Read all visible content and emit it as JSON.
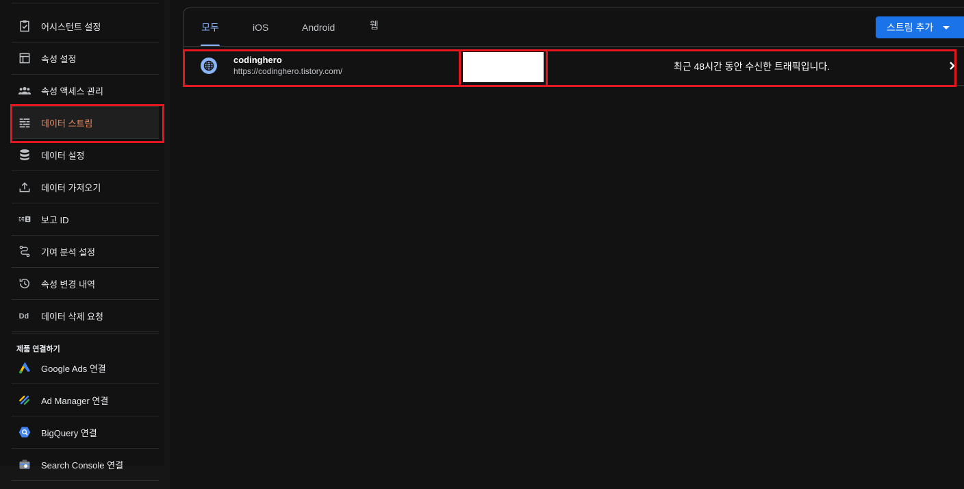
{
  "sidebar": {
    "items": [
      {
        "label": "어시스턴트 설정",
        "icon": "clipboard-check-icon"
      },
      {
        "label": "속성 설정",
        "icon": "property-frame-icon"
      },
      {
        "label": "속성 액세스 관리",
        "icon": "people-icon"
      },
      {
        "label": "데이터 스트림",
        "icon": "data-streams-icon"
      },
      {
        "label": "데이터 설정",
        "icon": "database-icon"
      },
      {
        "label": "데이터 가져오기",
        "icon": "upload-icon"
      },
      {
        "label": "보고 ID",
        "icon": "reporting-id-icon"
      },
      {
        "label": "기여 분석 설정",
        "icon": "attribution-path-icon"
      },
      {
        "label": "속성 변경 내역",
        "icon": "history-icon"
      },
      {
        "label": "데이터 삭제 요청",
        "icon": "data-deletion-icon"
      }
    ],
    "section_title": "제품 연결하기",
    "links": [
      {
        "label": "Google Ads 연결",
        "icon": "google-ads-icon"
      },
      {
        "label": "Ad Manager 연결",
        "icon": "ad-manager-icon"
      },
      {
        "label": "BigQuery 연결",
        "icon": "bigquery-icon"
      },
      {
        "label": "Search Console 연결",
        "icon": "search-console-icon"
      }
    ]
  },
  "tabs": [
    "모두",
    "iOS",
    "Android",
    "웹"
  ],
  "add_stream_label": "스트림 추가",
  "stream": {
    "name": "codinghero",
    "url": "https://codinghero.tistory.com/",
    "traffic_text": "최근 48시간 동안 수신한 트래픽입니다."
  },
  "colors": {
    "accent_blue": "#8ab4f8",
    "button_blue": "#1a73e8",
    "highlight_red": "#e4161f",
    "active_orange": "#f28b5e"
  }
}
